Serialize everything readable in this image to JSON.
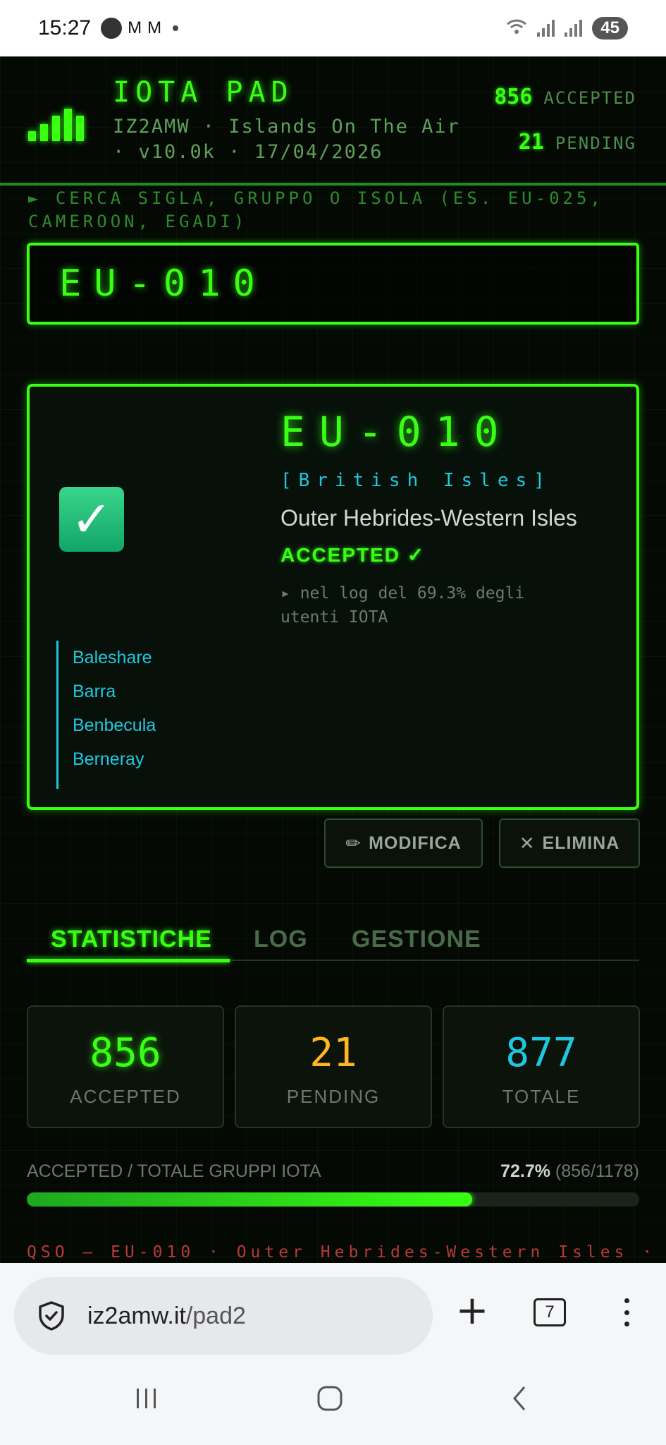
{
  "status_bar": {
    "time": "15:27",
    "notif_icons": [
      "M",
      "M"
    ],
    "battery": "45"
  },
  "header": {
    "title": "IOTA PAD",
    "subtitle": "IZ2AMW · Islands On The Air · v10.0k · 17/04/2026",
    "accepted_count": "856",
    "accepted_label": "ACCEPTED",
    "pending_count": "21",
    "pending_label": "PENDING"
  },
  "search": {
    "label": "► CERCA SIGLA, GRUPPO O ISOLA (ES. EU-025, CAMEROON, EGADI)",
    "value": "EU-010"
  },
  "result": {
    "icon": "check-mark-icon",
    "code": "EU-010",
    "group": "[British Isles]",
    "name": "Outer Hebrides-Western Isles",
    "status": "ACCEPTED ✓",
    "log_pct": "▸ nel log del 69.3% degli utenti IOTA",
    "islands": [
      "Baleshare",
      "Barra",
      "Benbecula",
      "Berneray",
      "-"
    ]
  },
  "actions": {
    "edit_label": "MODIFICA",
    "delete_label": "ELIMINA"
  },
  "tabs": [
    "STATISTICHE",
    "LOG",
    "GESTIONE"
  ],
  "stats": [
    {
      "value": "856",
      "label": "ACCEPTED"
    },
    {
      "value": "21",
      "label": "PENDING"
    },
    {
      "value": "877",
      "label": "TOTALE"
    }
  ],
  "progress": {
    "label": "ACCEPTED / TOTALE GRUPPI IOTA",
    "percent_text": "72.7%",
    "ratio_text": "(856/1178)",
    "fraction": 0.727
  },
  "ticker": "QSO — EU-010 · Outer Hebrides-Western Isles ·",
  "browser": {
    "domain": "iz2amw.it",
    "path": "/pad2",
    "tab_count": "7"
  },
  "colors": {
    "accent": "#39ff14",
    "pending": "#ffb81f",
    "total": "#1ec8e0",
    "background": "#040904"
  }
}
